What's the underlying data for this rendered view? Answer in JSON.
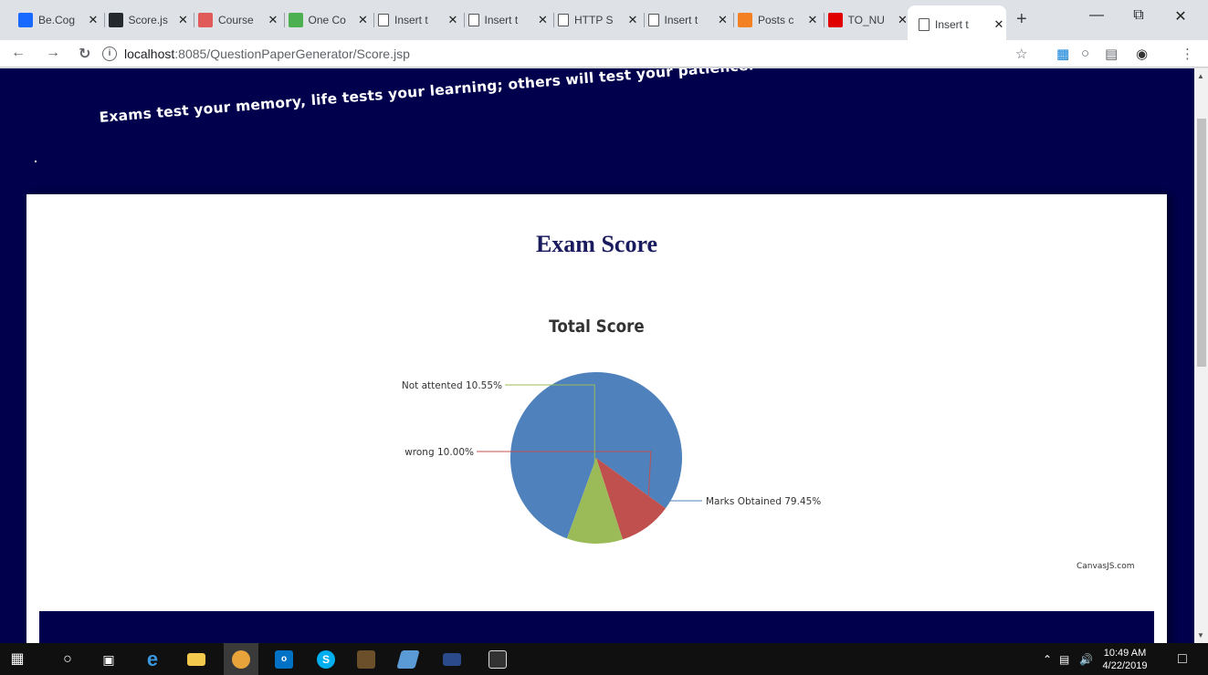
{
  "browser": {
    "tabs": [
      {
        "title": "Be.Cog",
        "icon": "behance-icon",
        "color": "#1769ff"
      },
      {
        "title": "Score.js",
        "icon": "github-icon",
        "color": "#24292e"
      },
      {
        "title": "Course",
        "icon": "course-icon",
        "color": "#e05a5a"
      },
      {
        "title": "One Co",
        "icon": "onecompiler-icon",
        "color": "#4caf50"
      },
      {
        "title": "Insert t",
        "icon": "document-icon",
        "color": "#ffffff"
      },
      {
        "title": "Insert t",
        "icon": "document-icon",
        "color": "#ffffff"
      },
      {
        "title": "HTTP S",
        "icon": "document-icon",
        "color": "#ffffff"
      },
      {
        "title": "Insert t",
        "icon": "document-icon",
        "color": "#ffffff"
      },
      {
        "title": "Posts c",
        "icon": "stackoverflow-icon",
        "color": "#f48024"
      },
      {
        "title": "TO_NU",
        "icon": "oracle-icon",
        "color": "#e00000"
      },
      {
        "title": "Insert t",
        "icon": "document-icon",
        "color": "#ffffff"
      }
    ],
    "active_tab": 10,
    "url_host": "localhost",
    "url_path": ":8085/QuestionPaperGenerator/Score.jsp"
  },
  "page": {
    "quote": "Exams test your memory, life tests your learning; others will test your patience.",
    "title": "Exam Score",
    "credit": "CanvasJS.com"
  },
  "chart_data": {
    "type": "pie",
    "title": "Total Score",
    "slices": [
      {
        "label": "Marks Obtained",
        "value": 79.45,
        "color": "#4f81bc",
        "display": "Marks Obtained 79.45%"
      },
      {
        "label": "wrong",
        "value": 10.0,
        "color": "#c0504e",
        "display": "wrong 10.00%"
      },
      {
        "label": "Not attented",
        "value": 10.55,
        "color": "#9bbb58",
        "display": "Not attented 10.55%"
      }
    ]
  },
  "taskbar": {
    "time": "10:49 AM",
    "date": "4/22/2019"
  }
}
